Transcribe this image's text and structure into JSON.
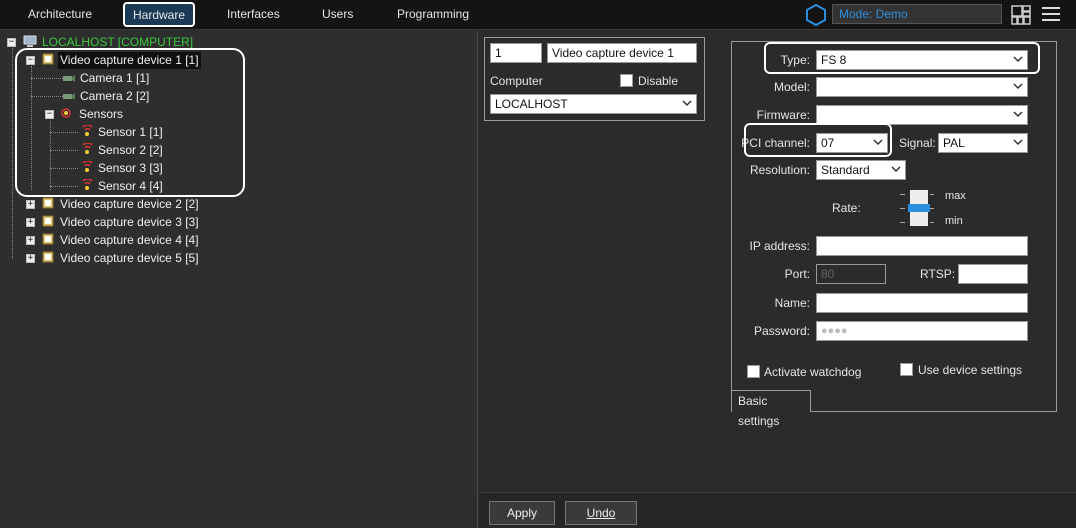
{
  "topbar": {
    "tabs": [
      "Architecture",
      "Hardware",
      "Interfaces",
      "Users",
      "Programming"
    ],
    "active_tab": "Hardware",
    "mode": "Mode: Demo"
  },
  "tree": {
    "root": "LOCALHOST [COMPUTER]",
    "device1": "Video capture device 1 [1]",
    "camera1": "Camera 1 [1]",
    "camera2": "Camera 2 [2]",
    "sensors": "Sensors",
    "sensor1": "Sensor 1 [1]",
    "sensor2": "Sensor 2 [2]",
    "sensor3": "Sensor 3 [3]",
    "sensor4": "Sensor 4 [4]",
    "device2": "Video capture device 2 [2]",
    "device3": "Video capture device 3 [3]",
    "device4": "Video capture device 4 [4]",
    "device5": "Video capture device 5 [5]"
  },
  "object": {
    "id": "1",
    "name": "Video capture device 1",
    "computer_label": "Computer",
    "disable_label": "Disable",
    "computer_value": "LOCALHOST"
  },
  "settings": {
    "type_label": "Type:",
    "type_value": "FS 8",
    "model_label": "Model:",
    "model_value": "",
    "firmware_label": "Firmware:",
    "firmware_value": "",
    "pci_label": "PCI channel:",
    "pci_value": "07",
    "signal_label": "Signal:",
    "signal_value": "PAL",
    "resolution_label": "Resolution:",
    "resolution_value": "Standard",
    "rate_label": "Rate:",
    "rate_max": "max",
    "rate_min": "min",
    "ip_label": "IP address:",
    "ip_value": "",
    "port_label": "Port:",
    "port_value": "80",
    "rtsp_label": "RTSP:",
    "rtsp_value": "",
    "name_label": "Name:",
    "name_value": "",
    "password_label": "Password:",
    "password_value": "●●●●",
    "watchdog_label": "Activate watchdog",
    "use_device_label": "Use device settings",
    "tab_label": "Basic settings"
  },
  "buttons": {
    "apply": "Apply",
    "undo": "Undo"
  },
  "colors": {
    "accent_blue": "#2d8fe0",
    "root_green": "#3cc83c"
  }
}
